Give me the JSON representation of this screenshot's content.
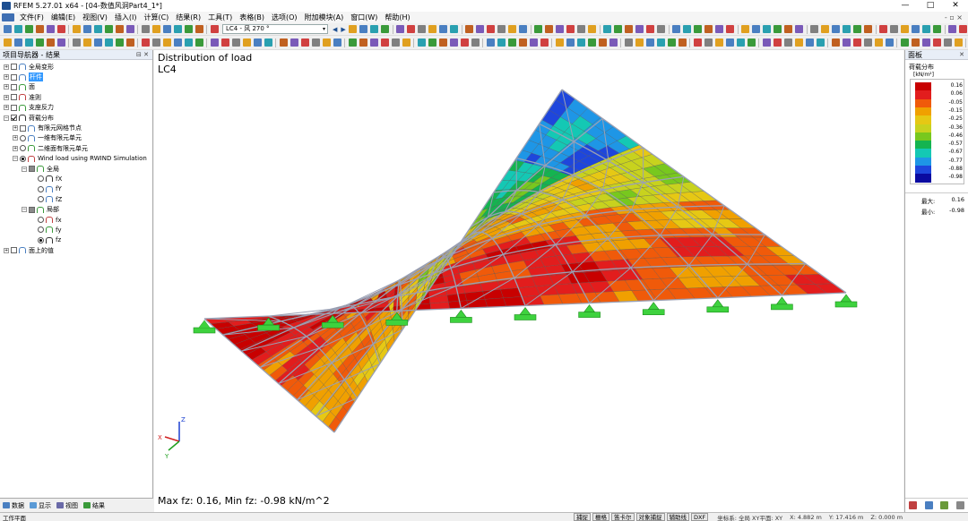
{
  "window": {
    "title": "RFEM 5.27.01 x64 - [04-数值风洞Part4_1*]",
    "min": "—",
    "max": "□",
    "close": "✕"
  },
  "menu": [
    "文件(F)",
    "编辑(E)",
    "视图(V)",
    "插入(I)",
    "计算(C)",
    "结果(R)",
    "工具(T)",
    "表格(B)",
    "选项(O)",
    "附加模块(A)",
    "窗口(W)",
    "帮助(H)"
  ],
  "menu_right": "- ▫ ×",
  "toolbar": {
    "load_case": "LC4 - 风 270 °",
    "dropdown": "▾",
    "prev": "◀",
    "next": "▶"
  },
  "navigator": {
    "title": "项目导航器 - 结果",
    "pin": "⊟ ✕",
    "items": [
      {
        "level": 0,
        "exp": "+",
        "check": "off",
        "label": "全局变形"
      },
      {
        "level": 0,
        "exp": "+",
        "check": "off",
        "label": "杆件",
        "highlight": true
      },
      {
        "level": 0,
        "exp": "+",
        "check": "off",
        "label": "面"
      },
      {
        "level": 0,
        "exp": "+",
        "check": "off",
        "label": "准则"
      },
      {
        "level": 0,
        "exp": "+",
        "check": "off",
        "label": "支座反力"
      },
      {
        "level": 0,
        "exp": "−",
        "check": "on",
        "label": "荷载分布"
      },
      {
        "level": 1,
        "exp": "+",
        "check": "off",
        "label": "有限元网格节点"
      },
      {
        "level": 1,
        "exp": "+",
        "radio": "off",
        "label": "一维有限元单元"
      },
      {
        "level": 1,
        "exp": "+",
        "radio": "off",
        "label": "二维面有限元单元"
      },
      {
        "level": 1,
        "exp": "−",
        "radio": "on",
        "label": "Wind load using RWIND Simulation"
      },
      {
        "level": 2,
        "exp": "−",
        "check": "part",
        "label": "全局"
      },
      {
        "level": 3,
        "radio": "off",
        "label": "fX"
      },
      {
        "level": 3,
        "radio": "off",
        "label": "fY"
      },
      {
        "level": 3,
        "radio": "off",
        "label": "fZ"
      },
      {
        "level": 2,
        "exp": "−",
        "check": "part",
        "label": "局部"
      },
      {
        "level": 3,
        "radio": "off",
        "label": "fx"
      },
      {
        "level": 3,
        "radio": "off",
        "label": "fy"
      },
      {
        "level": 3,
        "radio": "on",
        "label": "fz"
      },
      {
        "level": 0,
        "exp": "+",
        "check": "off",
        "label": "面上的值"
      }
    ],
    "tabs": [
      "数据",
      "显示",
      "视图",
      "结果"
    ]
  },
  "canvas": {
    "title": "Distribution of load",
    "load_case": "LC4",
    "footer": "Max fz: 0.16, Min fz: -0.98 kN/m^2",
    "axes": {
      "x": "X",
      "y": "Y",
      "z": "Z"
    }
  },
  "panel": {
    "header": "面板",
    "legend_title": "荷载分布",
    "legend_unit": "[kN/m²]",
    "legend": [
      {
        "value": "0.16",
        "color": "#c80000"
      },
      {
        "value": "0.06",
        "color": "#e21d1d"
      },
      {
        "value": "-0.05",
        "color": "#f05a0a"
      },
      {
        "value": "-0.15",
        "color": "#f0a000"
      },
      {
        "value": "-0.25",
        "color": "#e6c814"
      },
      {
        "value": "-0.36",
        "color": "#c8d21e"
      },
      {
        "value": "-0.46",
        "color": "#78c81e"
      },
      {
        "value": "-0.57",
        "color": "#14b450"
      },
      {
        "value": "-0.67",
        "color": "#14c8b4"
      },
      {
        "value": "-0.77",
        "color": "#1e96e6"
      },
      {
        "value": "-0.88",
        "color": "#1e46dc"
      },
      {
        "value": "-0.98",
        "color": "#0a0aa0"
      }
    ],
    "max_label": "最大:",
    "max_value": "0.16",
    "min_label": "最小:",
    "min_value": "-0.98"
  },
  "status": {
    "left": "工作平面",
    "buttons": [
      "捕捉",
      "栅格",
      "笛卡尔",
      "对象捕捉",
      "辅助线",
      "DXF"
    ],
    "coord": "坐标系: 全局 XY平面: XY",
    "x": "X: 4.882 m",
    "y": "Y: 17.416 m",
    "z": "Z: 0.000 m"
  },
  "colors": {
    "support": "#3ed23e",
    "mesh": "#555555",
    "grid": "#9aa0b4",
    "highlight": "#3399ff"
  }
}
